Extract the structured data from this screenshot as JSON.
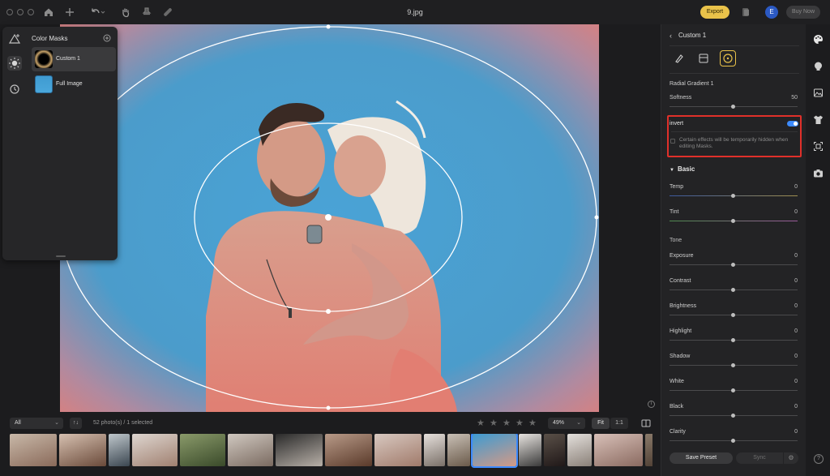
{
  "window": {
    "title": "9.jpg"
  },
  "toolbar": {
    "export_label": "Export",
    "avatar_initial": "E",
    "buy_now_label": "Buy Now",
    "icons": [
      "home-icon",
      "plus-icon",
      "undo-icon",
      "hand-icon",
      "stamp-icon",
      "bandage-icon",
      "layers-icon"
    ]
  },
  "masks_panel": {
    "title": "Color Masks",
    "items": [
      {
        "label": "Custom 1",
        "selected": true
      },
      {
        "label": "Full Image",
        "selected": false
      }
    ]
  },
  "filmstrip": {
    "filter_value": "All",
    "sort_label": "↑↓",
    "photo_count": "52 photo(s) / 1 selected",
    "zoom_value": "49%",
    "fit_label": "Fit",
    "one_to_one_label": "1:1",
    "selected_index": 15
  },
  "right_panel": {
    "back_title": "Custom 1",
    "section_title": "Radial Gradient 1",
    "softness": {
      "label": "Softness",
      "value": "50",
      "fraction": 0.5
    },
    "invert": {
      "label": "invert",
      "enabled": true,
      "note": "Certain effects will be temporarily hidden when editing Masks."
    },
    "basic": {
      "title": "Basic",
      "temp": {
        "label": "Temp",
        "value": "0"
      },
      "tint": {
        "label": "Tint",
        "value": "0"
      },
      "tone_label": "Tone",
      "tone": [
        {
          "label": "Exposure",
          "value": "0"
        },
        {
          "label": "Contrast",
          "value": "0"
        },
        {
          "label": "Brightness",
          "value": "0"
        },
        {
          "label": "Highlight",
          "value": "0"
        },
        {
          "label": "Shadow",
          "value": "0"
        },
        {
          "label": "White",
          "value": "0"
        },
        {
          "label": "Black",
          "value": "0"
        },
        {
          "label": "Clarity",
          "value": "0"
        }
      ]
    },
    "save_preset_label": "Save Preset",
    "sync_label": "Sync"
  },
  "help_label": "?",
  "info_label": "i",
  "colors": {
    "accent": "#e9c24a",
    "selection": "#3d8bff",
    "highlight_box": "#e0302a",
    "sky": "#4a9fd0",
    "vignette": "#d98a8a"
  }
}
